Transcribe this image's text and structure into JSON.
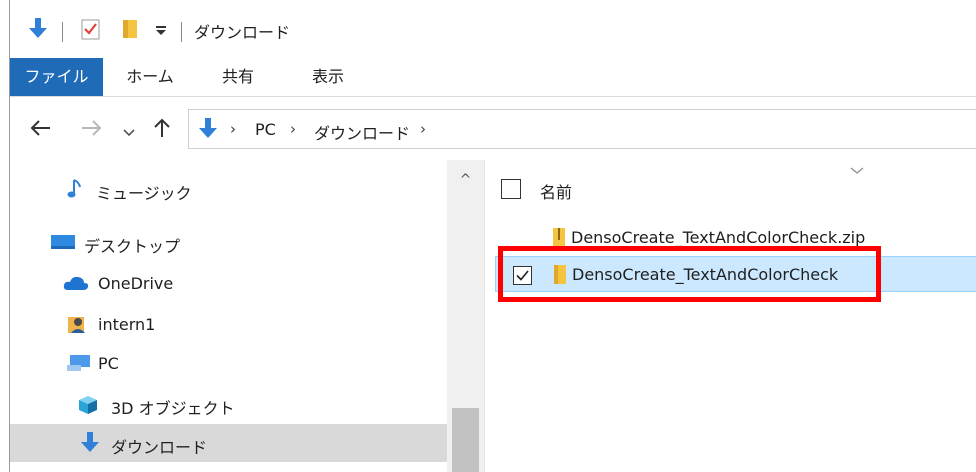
{
  "title": "ダウンロード",
  "ribbon": {
    "tabs": [
      "ファイル",
      "ホーム",
      "共有",
      "表示"
    ]
  },
  "address": {
    "crumbs": [
      "PC",
      "ダウンロード"
    ]
  },
  "nav": {
    "items": [
      "ミュージック",
      "デスクトップ",
      "OneDrive",
      "intern1",
      "PC",
      "3D オブジェクト",
      "ダウンロード"
    ]
  },
  "content": {
    "column_name": "名前",
    "files": [
      {
        "name": "DensoCreate_TextAndColorCheck.zip",
        "checked": false
      },
      {
        "name": "DensoCreate_TextAndColorCheck",
        "checked": true
      }
    ]
  },
  "colors": {
    "file_tab": "#1f6bb8",
    "selection": "#cce8ff",
    "highlight_box": "#ff0000"
  },
  "icons": [
    "download-arrow-icon",
    "properties-icon",
    "folder-icon",
    "qat-dropdown-icon",
    "back-arrow-icon",
    "forward-arrow-icon",
    "recent-dropdown-icon",
    "up-arrow-icon",
    "music-note-icon",
    "desktop-icon",
    "onedrive-cloud-icon",
    "user-icon",
    "pc-icon",
    "3d-objects-icon",
    "zip-folder-icon"
  ]
}
